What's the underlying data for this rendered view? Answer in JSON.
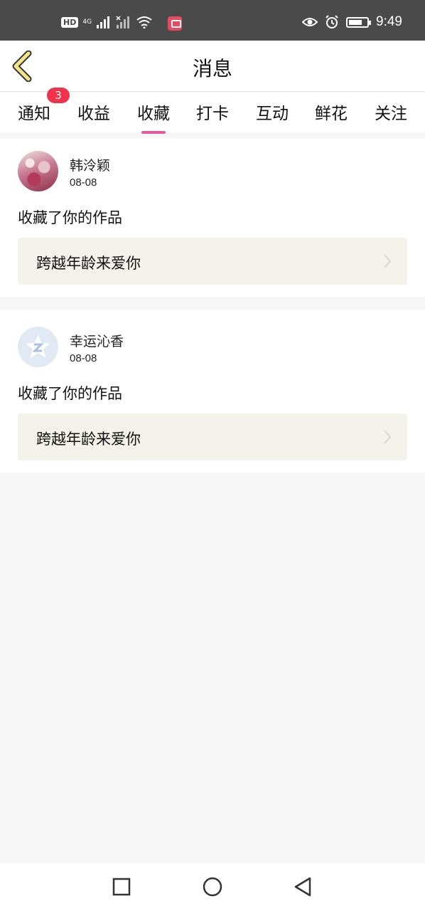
{
  "status_bar": {
    "time": "9:49",
    "hd_label": "HD",
    "network_label": "4G",
    "icons": [
      "hd-icon",
      "signal-icon",
      "signal-x-icon",
      "wifi-icon",
      "app-notification-icon",
      "eye-icon",
      "alarm-icon",
      "battery-icon"
    ]
  },
  "header": {
    "title": "消息",
    "back_icon": "chevron-left-icon"
  },
  "tabs": [
    {
      "label": "通知",
      "badge": "3"
    },
    {
      "label": "收益"
    },
    {
      "label": "收藏",
      "active": true
    },
    {
      "label": "打卡"
    },
    {
      "label": "互动"
    },
    {
      "label": "鲜花"
    },
    {
      "label": "关注"
    }
  ],
  "accent_color": "#e45b9b",
  "badge_color": "#f0334a",
  "messages": [
    {
      "user": "韩泠颖",
      "date": "08-08",
      "action": "收藏了你的作品",
      "work_title": "跨越年龄来爱你"
    },
    {
      "user": "幸运沁香",
      "date": "08-08",
      "action": "收藏了你的作品",
      "work_title": "跨越年龄来爱你"
    }
  ],
  "nav_bar": {
    "icons": [
      "recent-apps-icon",
      "home-icon",
      "back-icon"
    ]
  }
}
